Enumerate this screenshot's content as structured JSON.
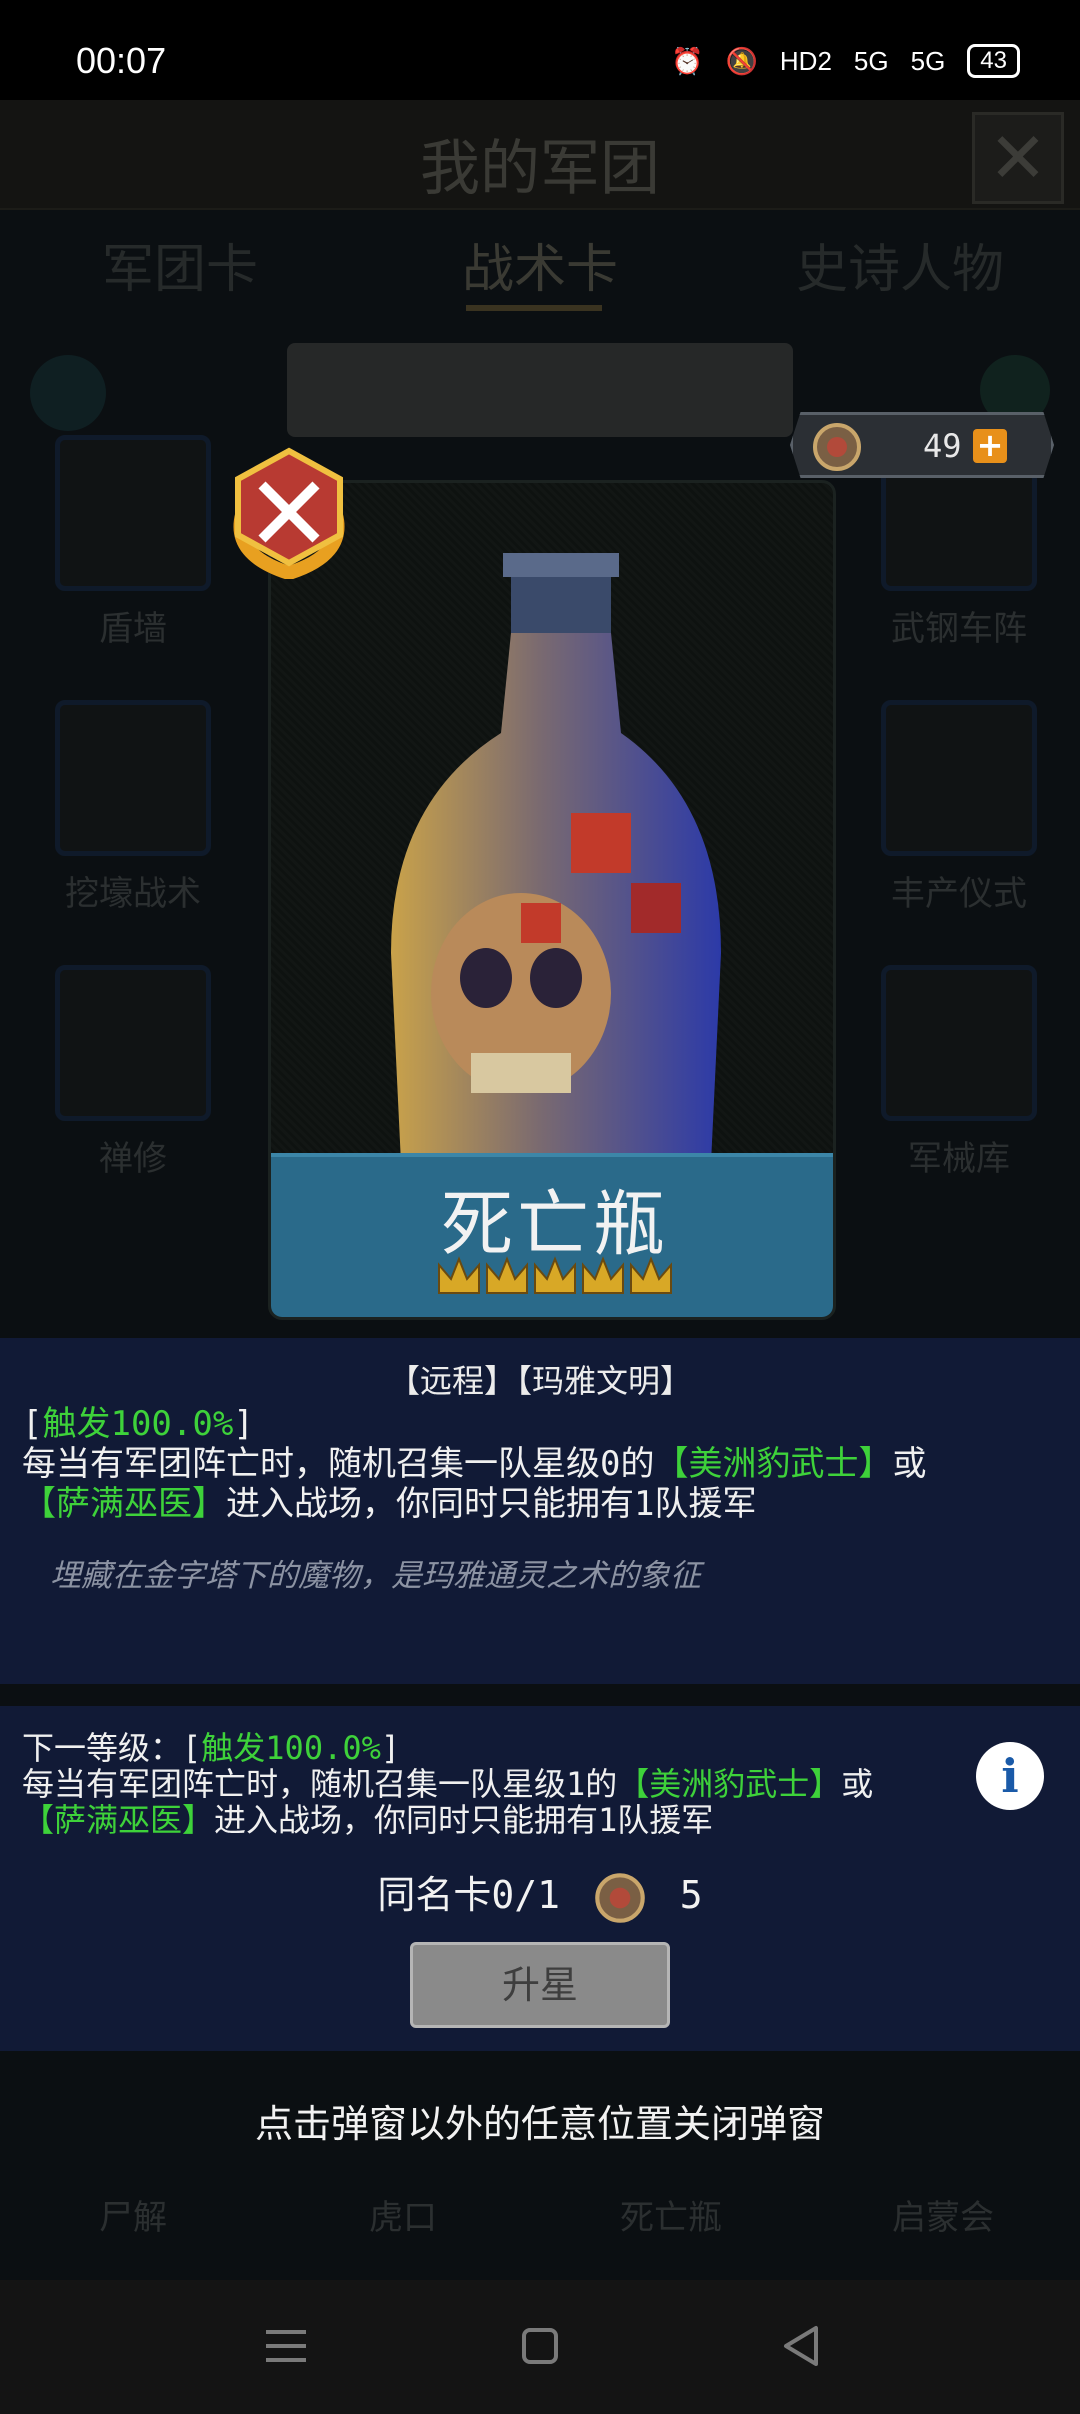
{
  "status": {
    "time": "00:07",
    "hd": "HD2",
    "net1": "5G",
    "net2": "5G",
    "battery": "43"
  },
  "header": {
    "title": "我的军团"
  },
  "tabs": [
    {
      "label": "军团卡"
    },
    {
      "label": "战术卡"
    },
    {
      "label": "史诗人物"
    }
  ],
  "grid_items": [
    {
      "label": "盾墙"
    },
    {
      "label": ""
    },
    {
      "label": ""
    },
    {
      "label": "武钢车阵"
    },
    {
      "label": "挖壕战术"
    },
    {
      "label": ""
    },
    {
      "label": ""
    },
    {
      "label": "丰产仪式"
    },
    {
      "label": "禅修"
    },
    {
      "label": ""
    },
    {
      "label": ""
    },
    {
      "label": "军械库"
    }
  ],
  "bottom_row": [
    {
      "label": "尸解"
    },
    {
      "label": "虎口"
    },
    {
      "label": "死亡瓶"
    },
    {
      "label": "启蒙会"
    }
  ],
  "currency": {
    "value": "49",
    "plus": "+"
  },
  "card": {
    "name": "死亡瓶"
  },
  "description": {
    "tags": "【远程】【玛雅文明】",
    "trigger_open": "[",
    "trigger": "触发100.0%",
    "trigger_close": "]",
    "line1_a": "每当有军团阵亡时，随机召集一队星级0的",
    "unit1": "【美洲豹武士】",
    "or": "或",
    "unit2": "【萨满巫医】",
    "line2_b": "进入战场，你同时只能拥有1队援军",
    "flavor": "埋藏在金字塔下的魔物，是玛雅通灵之术的象征"
  },
  "next_level": {
    "prefix": "下一等级：[",
    "trigger": "触发100.0%",
    "trigger_close": "]",
    "line1_a": "每当有军团阵亡时，随机召集一队星级1的",
    "unit1": "【美洲豹武士】",
    "or": "或",
    "unit2": "【萨满巫医】",
    "line2_b": "进入战场，你同时只能拥有1队援军",
    "info": "i"
  },
  "duplicate": {
    "label": "同名卡0/1",
    "cost": "5"
  },
  "upgrade_button": {
    "label": "升星"
  },
  "close_hint": "点击弹窗以外的任意位置关闭弹窗",
  "colors": {
    "highlight": "#3ed23a",
    "panel": "#111a36",
    "nameplate": "#2a6a8a"
  }
}
